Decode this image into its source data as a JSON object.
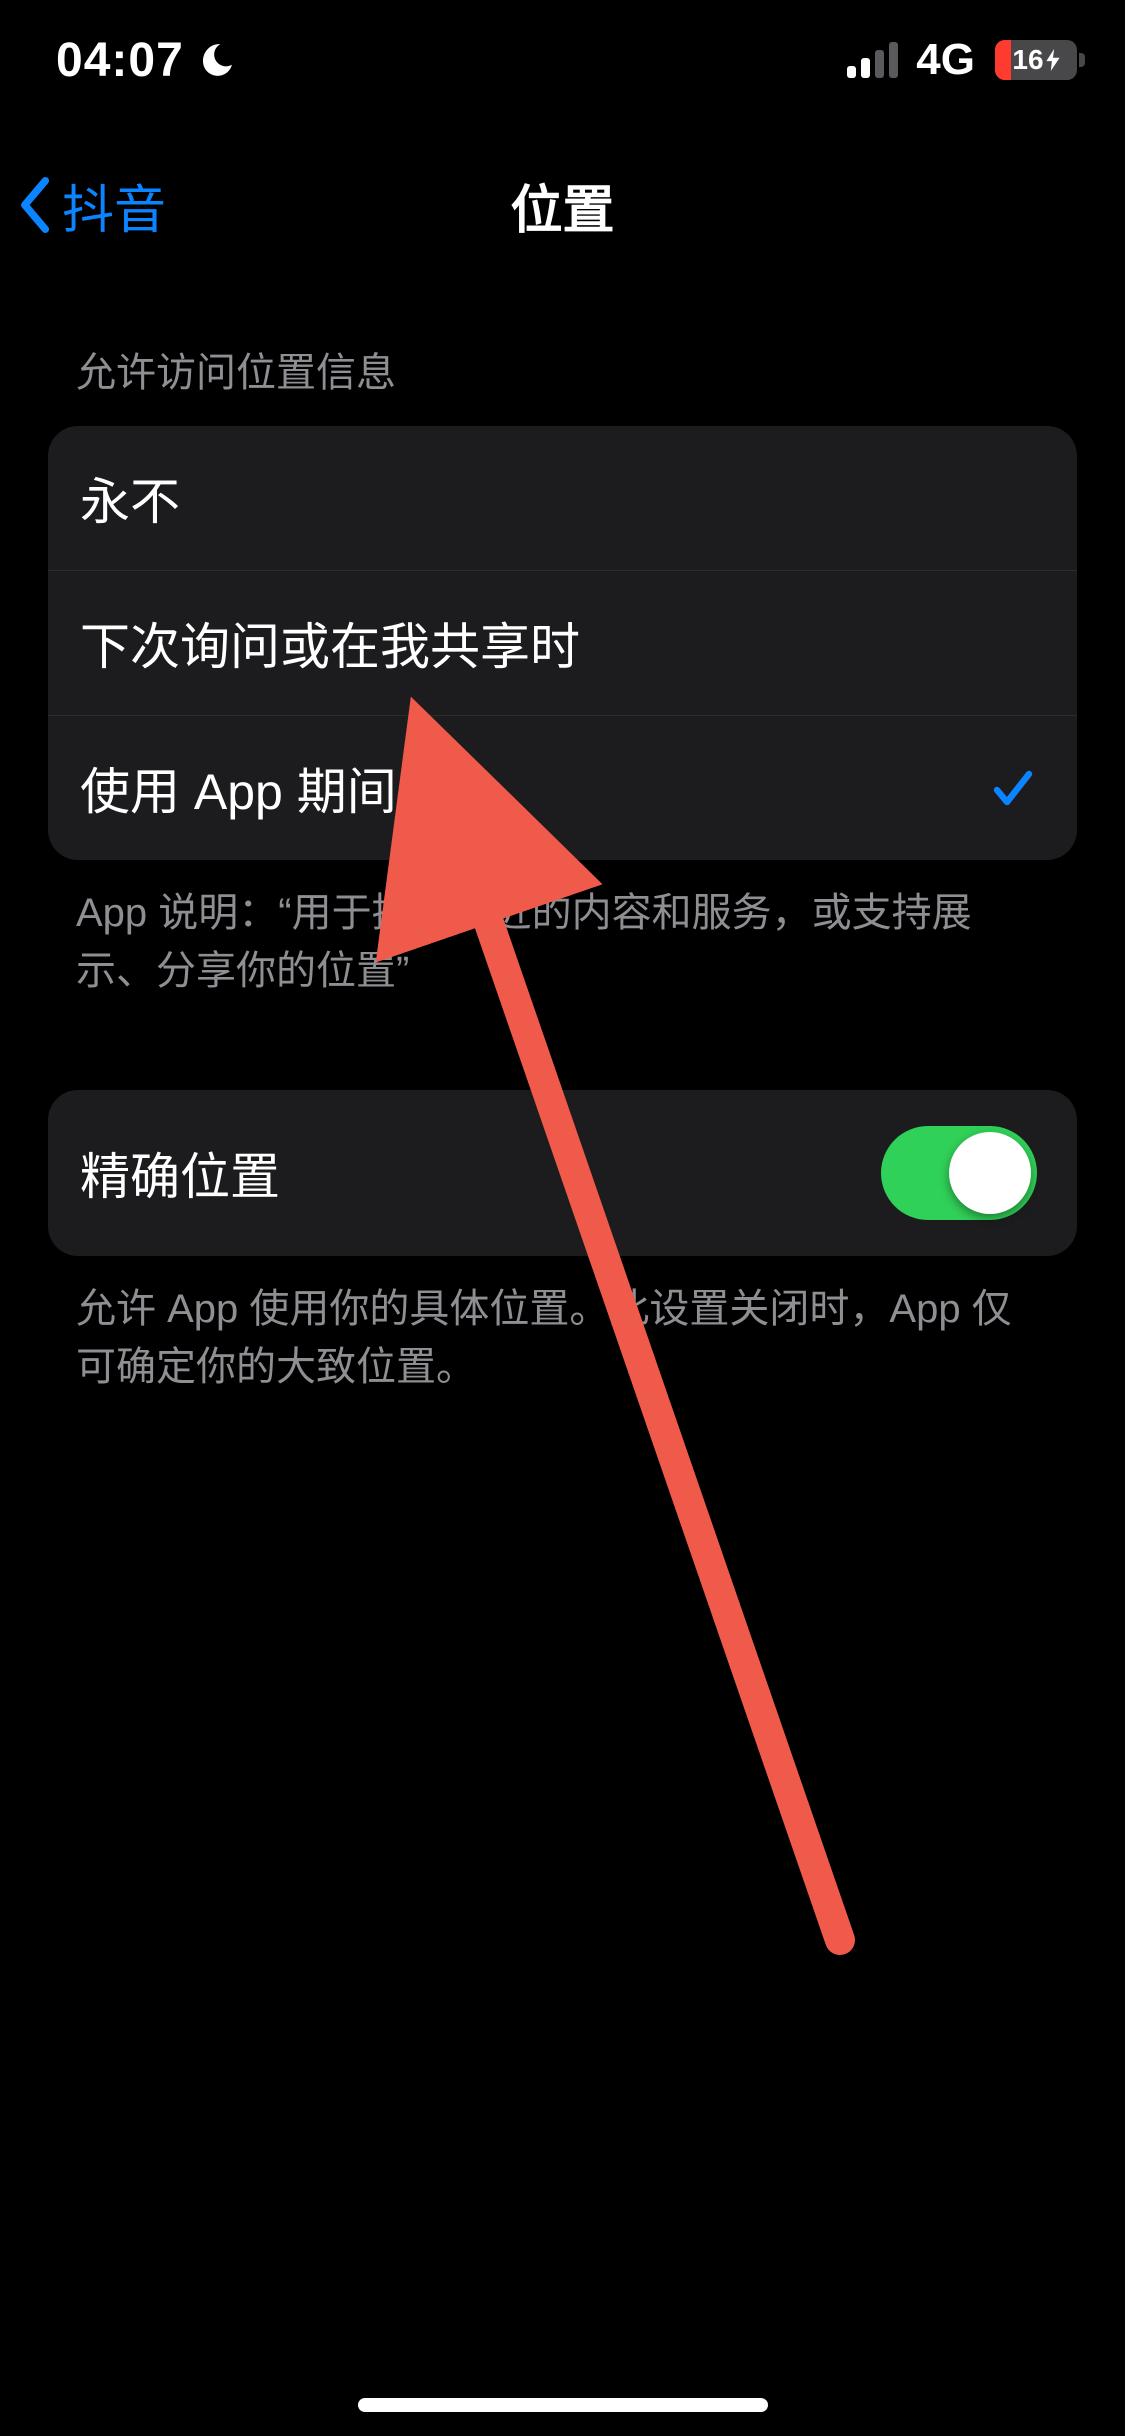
{
  "status": {
    "time": "04:07",
    "network_type": "4G",
    "battery_percent": "16",
    "battery_fill_pct": 20,
    "signal_strength": 2
  },
  "nav": {
    "back_label": "抖音",
    "title": "位置"
  },
  "location_section": {
    "header": "允许访问位置信息",
    "options": [
      {
        "label": "永不",
        "selected": false
      },
      {
        "label": "下次询问或在我共享时",
        "selected": false
      },
      {
        "label": "使用 App 期间",
        "selected": true
      }
    ],
    "footer": "App 说明：“用于推荐附近的内容和服务，或支持展示、分享你的位置”"
  },
  "precise_section": {
    "label": "精确位置",
    "enabled": true,
    "footer": "允许 App 使用你的具体位置。此设置关闭时，App 仅可确定你的大致位置。"
  },
  "colors": {
    "accent_blue": "#0a84ff",
    "toggle_green": "#30d158",
    "battery_low": "#ff3b30",
    "annotation_red": "#f05a4b"
  }
}
